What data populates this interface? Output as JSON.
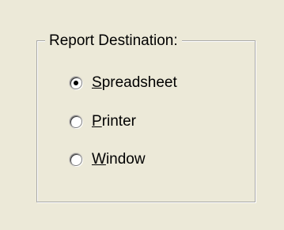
{
  "group": {
    "title": "Report Destination:"
  },
  "options": [
    {
      "accel": "S",
      "rest": "preadsheet",
      "selected": true
    },
    {
      "accel": "P",
      "rest": "rinter",
      "selected": false
    },
    {
      "accel": "W",
      "rest": "indow",
      "selected": false
    }
  ],
  "colors": {
    "background": "#ece9d8",
    "group_border": "#a9a9a9"
  }
}
